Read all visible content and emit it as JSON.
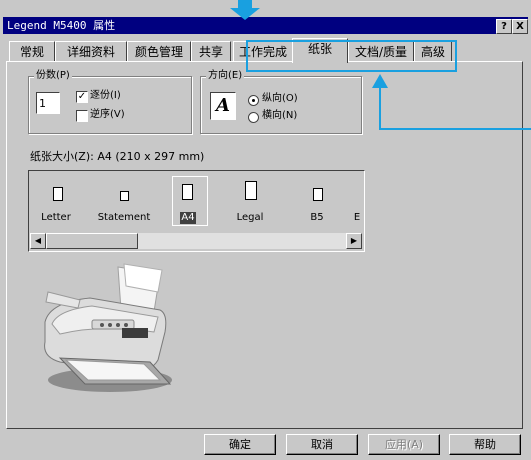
{
  "window": {
    "title": "Legend M5400 属性",
    "help_button": "?",
    "close_button": "X"
  },
  "tabs": [
    {
      "label": "常规"
    },
    {
      "label": "详细资料"
    },
    {
      "label": "颜色管理"
    },
    {
      "label": "共享"
    },
    {
      "label": "工作完成"
    },
    {
      "label": "纸张"
    },
    {
      "label": "文档/质量"
    },
    {
      "label": "高级"
    }
  ],
  "copies": {
    "group_label": "份数(P)",
    "count": "1",
    "collate_label": "逐份(I)",
    "collate_checked": true,
    "reverse_label": "逆序(V)",
    "reverse_checked": false
  },
  "orientation": {
    "group_label": "方向(E)",
    "preview_letter": "A",
    "portrait_label": "纵向(O)",
    "landscape_label": "横向(N)",
    "selected": "portrait"
  },
  "paper_size": {
    "label": "纸张大小(Z): A4 (210 x 297 mm)",
    "items": [
      {
        "label": "Letter",
        "selected": false
      },
      {
        "label": "Statement",
        "selected": false
      },
      {
        "label": "A4",
        "selected": true
      },
      {
        "label": "Legal",
        "selected": false
      },
      {
        "label": "B5",
        "selected": false
      },
      {
        "label": "E",
        "selected": false
      }
    ]
  },
  "buttons": {
    "ok": "确定",
    "cancel": "取消",
    "apply": "应用(A)",
    "help": "帮助"
  },
  "colors": {
    "highlight": "#19a0e0",
    "titlebar": "#000080",
    "face": "#c8c8c8"
  }
}
